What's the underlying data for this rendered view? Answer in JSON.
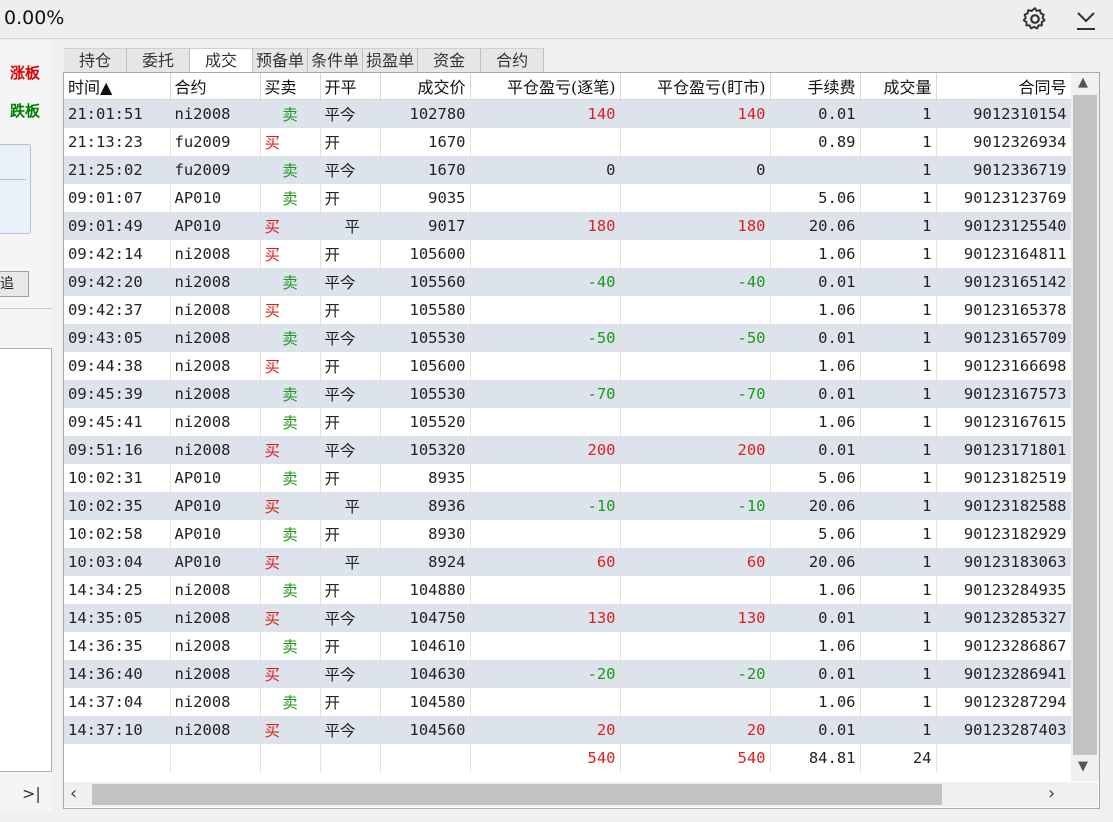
{
  "header": {
    "percent": "0.00%",
    "gear_icon": "gear-icon",
    "collapse_icon": "collapse-down-icon"
  },
  "left_panel": {
    "limit_up": "涨板",
    "limit_down": "跌板",
    "button_label": "追",
    "nav_arrow": ">|"
  },
  "tabs": [
    "持仓",
    "委托",
    "成交",
    "预备单",
    "条件单",
    "损盈单",
    "资金",
    "合约"
  ],
  "active_tab": "成交",
  "columns": [
    "时间▲",
    "合约",
    "买卖",
    "开平",
    "成交价",
    "平仓盈亏(逐笔)",
    "平仓盈亏(盯市)",
    "手续费",
    "成交量",
    "合同号"
  ],
  "rows": [
    [
      "21:01:51",
      "ni2008",
      "卖",
      "平今",
      "102780",
      "140",
      "140",
      "0.01",
      "1",
      "9012310154"
    ],
    [
      "21:13:23",
      "fu2009",
      "买",
      "开",
      "1670",
      "",
      "",
      "0.89",
      "1",
      "9012326934"
    ],
    [
      "21:25:02",
      "fu2009",
      "卖",
      "平今",
      "1670",
      "0",
      "0",
      "",
      "1",
      "9012336719"
    ],
    [
      "09:01:07",
      "AP010",
      "卖",
      "开",
      "9035",
      "",
      "",
      "5.06",
      "1",
      "90123123769"
    ],
    [
      "09:01:49",
      "AP010",
      "买",
      "平",
      "9017",
      "180",
      "180",
      "20.06",
      "1",
      "90123125540"
    ],
    [
      "09:42:14",
      "ni2008",
      "买",
      "开",
      "105600",
      "",
      "",
      "1.06",
      "1",
      "90123164811"
    ],
    [
      "09:42:20",
      "ni2008",
      "卖",
      "平今",
      "105560",
      "-40",
      "-40",
      "0.01",
      "1",
      "90123165142"
    ],
    [
      "09:42:37",
      "ni2008",
      "买",
      "开",
      "105580",
      "",
      "",
      "1.06",
      "1",
      "90123165378"
    ],
    [
      "09:43:05",
      "ni2008",
      "卖",
      "平今",
      "105530",
      "-50",
      "-50",
      "0.01",
      "1",
      "90123165709"
    ],
    [
      "09:44:38",
      "ni2008",
      "买",
      "开",
      "105600",
      "",
      "",
      "1.06",
      "1",
      "90123166698"
    ],
    [
      "09:45:39",
      "ni2008",
      "卖",
      "平今",
      "105530",
      "-70",
      "-70",
      "0.01",
      "1",
      "90123167573"
    ],
    [
      "09:45:41",
      "ni2008",
      "卖",
      "开",
      "105520",
      "",
      "",
      "1.06",
      "1",
      "90123167615"
    ],
    [
      "09:51:16",
      "ni2008",
      "买",
      "平今",
      "105320",
      "200",
      "200",
      "0.01",
      "1",
      "90123171801"
    ],
    [
      "10:02:31",
      "AP010",
      "卖",
      "开",
      "8935",
      "",
      "",
      "5.06",
      "1",
      "90123182519"
    ],
    [
      "10:02:35",
      "AP010",
      "买",
      "平",
      "8936",
      "-10",
      "-10",
      "20.06",
      "1",
      "90123182588"
    ],
    [
      "10:02:58",
      "AP010",
      "卖",
      "开",
      "8930",
      "",
      "",
      "5.06",
      "1",
      "90123182929"
    ],
    [
      "10:03:04",
      "AP010",
      "买",
      "平",
      "8924",
      "60",
      "60",
      "20.06",
      "1",
      "90123183063"
    ],
    [
      "14:34:25",
      "ni2008",
      "卖",
      "开",
      "104880",
      "",
      "",
      "1.06",
      "1",
      "90123284935"
    ],
    [
      "14:35:05",
      "ni2008",
      "买",
      "平今",
      "104750",
      "130",
      "130",
      "0.01",
      "1",
      "90123285327"
    ],
    [
      "14:36:35",
      "ni2008",
      "卖",
      "开",
      "104610",
      "",
      "",
      "1.06",
      "1",
      "90123286867"
    ],
    [
      "14:36:40",
      "ni2008",
      "买",
      "平今",
      "104630",
      "-20",
      "-20",
      "0.01",
      "1",
      "90123286941"
    ],
    [
      "14:37:04",
      "ni2008",
      "卖",
      "开",
      "104580",
      "",
      "",
      "1.06",
      "1",
      "90123287294"
    ],
    [
      "14:37:10",
      "ni2008",
      "买",
      "平今",
      "104560",
      "20",
      "20",
      "0.01",
      "1",
      "90123287403"
    ]
  ],
  "totals": {
    "pnl_by_trade": "540",
    "pnl_mark_to_market": "540",
    "fee": "84.81",
    "volume": "24"
  },
  "colors": {
    "buy": "#e02020",
    "sell": "#1a9a1a",
    "stripe": "#dde3ea"
  }
}
